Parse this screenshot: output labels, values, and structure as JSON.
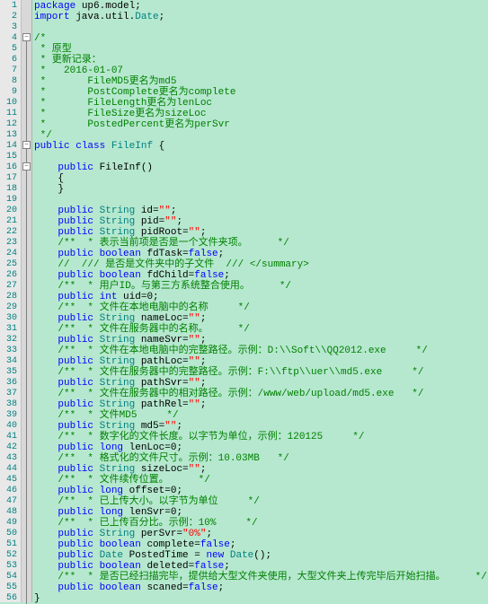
{
  "lines": [
    {
      "n": 1,
      "t": [
        {
          "c": "kw",
          "s": "package"
        },
        {
          "c": "",
          "s": " up6.model;"
        }
      ]
    },
    {
      "n": 2,
      "t": [
        {
          "c": "kw",
          "s": "import"
        },
        {
          "c": "",
          "s": " java.util."
        },
        {
          "c": "cls",
          "s": "Date"
        },
        {
          "c": "",
          "s": ";"
        }
      ]
    },
    {
      "n": 3,
      "t": []
    },
    {
      "n": 4,
      "t": [
        {
          "c": "cmt",
          "s": "/*"
        }
      ]
    },
    {
      "n": 5,
      "t": [
        {
          "c": "cmt",
          "s": " * 原型"
        }
      ]
    },
    {
      "n": 6,
      "t": [
        {
          "c": "cmt",
          "s": " * 更新记录："
        }
      ]
    },
    {
      "n": 7,
      "t": [
        {
          "c": "cmt",
          "s": " *   2016-01-07"
        }
      ]
    },
    {
      "n": 8,
      "t": [
        {
          "c": "cmt",
          "s": " *       FileMD5更名为md5"
        }
      ]
    },
    {
      "n": 9,
      "t": [
        {
          "c": "cmt",
          "s": " *       PostComplete更名为complete"
        }
      ]
    },
    {
      "n": 10,
      "t": [
        {
          "c": "cmt",
          "s": " *       FileLength更名为lenLoc"
        }
      ]
    },
    {
      "n": 11,
      "t": [
        {
          "c": "cmt",
          "s": " *       FileSize更名为sizeLoc"
        }
      ]
    },
    {
      "n": 12,
      "t": [
        {
          "c": "cmt",
          "s": " *       PostedPercent更名为perSvr"
        }
      ]
    },
    {
      "n": 13,
      "t": [
        {
          "c": "cmt",
          "s": " */"
        }
      ]
    },
    {
      "n": 14,
      "t": [
        {
          "c": "kw",
          "s": "public"
        },
        {
          "c": "",
          "s": " "
        },
        {
          "c": "kw",
          "s": "class"
        },
        {
          "c": "",
          "s": " "
        },
        {
          "c": "cls",
          "s": "FileInf"
        },
        {
          "c": "",
          "s": " {"
        }
      ]
    },
    {
      "n": 15,
      "t": []
    },
    {
      "n": 16,
      "t": [
        {
          "c": "",
          "s": "    "
        },
        {
          "c": "kw",
          "s": "public"
        },
        {
          "c": "",
          "s": " FileInf()"
        }
      ]
    },
    {
      "n": 17,
      "t": [
        {
          "c": "",
          "s": "    {"
        }
      ]
    },
    {
      "n": 18,
      "t": [
        {
          "c": "",
          "s": "    }"
        }
      ]
    },
    {
      "n": 19,
      "t": []
    },
    {
      "n": 20,
      "t": [
        {
          "c": "",
          "s": "    "
        },
        {
          "c": "kw",
          "s": "public"
        },
        {
          "c": "",
          "s": " "
        },
        {
          "c": "cls",
          "s": "String"
        },
        {
          "c": "",
          "s": " id="
        },
        {
          "c": "str",
          "s": "\"\""
        },
        {
          "c": "",
          "s": ";"
        }
      ]
    },
    {
      "n": 21,
      "t": [
        {
          "c": "",
          "s": "    "
        },
        {
          "c": "kw",
          "s": "public"
        },
        {
          "c": "",
          "s": " "
        },
        {
          "c": "cls",
          "s": "String"
        },
        {
          "c": "",
          "s": " pid="
        },
        {
          "c": "str",
          "s": "\"\""
        },
        {
          "c": "",
          "s": ";"
        }
      ]
    },
    {
      "n": 22,
      "t": [
        {
          "c": "",
          "s": "    "
        },
        {
          "c": "kw",
          "s": "public"
        },
        {
          "c": "",
          "s": " "
        },
        {
          "c": "cls",
          "s": "String"
        },
        {
          "c": "",
          "s": " pidRoot="
        },
        {
          "c": "str",
          "s": "\"\""
        },
        {
          "c": "",
          "s": ";"
        }
      ]
    },
    {
      "n": 23,
      "t": [
        {
          "c": "",
          "s": "    "
        },
        {
          "c": "cmt",
          "s": "/**  * 表示当前项是否是一个文件夹项。     */"
        }
      ]
    },
    {
      "n": 24,
      "t": [
        {
          "c": "",
          "s": "    "
        },
        {
          "c": "kw",
          "s": "public"
        },
        {
          "c": "",
          "s": " "
        },
        {
          "c": "kw",
          "s": "boolean"
        },
        {
          "c": "",
          "s": " fdTask="
        },
        {
          "c": "kw",
          "s": "false"
        },
        {
          "c": "",
          "s": ";"
        }
      ]
    },
    {
      "n": 25,
      "t": [
        {
          "c": "",
          "s": "    "
        },
        {
          "c": "cmt",
          "s": "//  /// 是否是文件夹中的子文件  /// </summary>"
        }
      ]
    },
    {
      "n": 26,
      "t": [
        {
          "c": "",
          "s": "    "
        },
        {
          "c": "kw",
          "s": "public"
        },
        {
          "c": "",
          "s": " "
        },
        {
          "c": "kw",
          "s": "boolean"
        },
        {
          "c": "",
          "s": " fdChild="
        },
        {
          "c": "kw",
          "s": "false"
        },
        {
          "c": "",
          "s": ";"
        }
      ]
    },
    {
      "n": 27,
      "t": [
        {
          "c": "",
          "s": "    "
        },
        {
          "c": "cmt",
          "s": "/**  * 用户ID。与第三方系统整合使用。     */"
        }
      ]
    },
    {
      "n": 28,
      "t": [
        {
          "c": "",
          "s": "    "
        },
        {
          "c": "kw",
          "s": "public"
        },
        {
          "c": "",
          "s": " "
        },
        {
          "c": "kw",
          "s": "int"
        },
        {
          "c": "",
          "s": " uid=0;"
        }
      ]
    },
    {
      "n": 29,
      "t": [
        {
          "c": "",
          "s": "    "
        },
        {
          "c": "cmt",
          "s": "/**  * 文件在本地电脑中的名称     */"
        }
      ]
    },
    {
      "n": 30,
      "t": [
        {
          "c": "",
          "s": "    "
        },
        {
          "c": "kw",
          "s": "public"
        },
        {
          "c": "",
          "s": " "
        },
        {
          "c": "cls",
          "s": "String"
        },
        {
          "c": "",
          "s": " nameLoc="
        },
        {
          "c": "str",
          "s": "\"\""
        },
        {
          "c": "",
          "s": ";"
        }
      ]
    },
    {
      "n": 31,
      "t": [
        {
          "c": "",
          "s": "    "
        },
        {
          "c": "cmt",
          "s": "/**  * 文件在服务器中的名称。     */"
        }
      ]
    },
    {
      "n": 32,
      "t": [
        {
          "c": "",
          "s": "    "
        },
        {
          "c": "kw",
          "s": "public"
        },
        {
          "c": "",
          "s": " "
        },
        {
          "c": "cls",
          "s": "String"
        },
        {
          "c": "",
          "s": " nameSvr="
        },
        {
          "c": "str",
          "s": "\"\""
        },
        {
          "c": "",
          "s": ";"
        }
      ]
    },
    {
      "n": 33,
      "t": [
        {
          "c": "",
          "s": "    "
        },
        {
          "c": "cmt",
          "s": "/**  * 文件在本地电脑中的完整路径。示例：D:\\\\Soft\\\\QQ2012.exe     */"
        }
      ]
    },
    {
      "n": 34,
      "t": [
        {
          "c": "",
          "s": "    "
        },
        {
          "c": "kw",
          "s": "public"
        },
        {
          "c": "",
          "s": " "
        },
        {
          "c": "cls",
          "s": "String"
        },
        {
          "c": "",
          "s": " pathLoc="
        },
        {
          "c": "str",
          "s": "\"\""
        },
        {
          "c": "",
          "s": ";"
        }
      ]
    },
    {
      "n": 35,
      "t": [
        {
          "c": "",
          "s": "    "
        },
        {
          "c": "cmt",
          "s": "/**  * 文件在服务器中的完整路径。示例：F:\\\\ftp\\\\uer\\\\md5.exe     */"
        }
      ]
    },
    {
      "n": 36,
      "t": [
        {
          "c": "",
          "s": "    "
        },
        {
          "c": "kw",
          "s": "public"
        },
        {
          "c": "",
          "s": " "
        },
        {
          "c": "cls",
          "s": "String"
        },
        {
          "c": "",
          "s": " pathSvr="
        },
        {
          "c": "str",
          "s": "\"\""
        },
        {
          "c": "",
          "s": ";"
        }
      ]
    },
    {
      "n": 37,
      "t": [
        {
          "c": "",
          "s": "    "
        },
        {
          "c": "cmt",
          "s": "/**  * 文件在服务器中的相对路径。示例：/www/web/upload/md5.exe   */"
        }
      ]
    },
    {
      "n": 38,
      "t": [
        {
          "c": "",
          "s": "    "
        },
        {
          "c": "kw",
          "s": "public"
        },
        {
          "c": "",
          "s": " "
        },
        {
          "c": "cls",
          "s": "String"
        },
        {
          "c": "",
          "s": " pathRel="
        },
        {
          "c": "str",
          "s": "\"\""
        },
        {
          "c": "",
          "s": ";"
        }
      ]
    },
    {
      "n": 39,
      "t": [
        {
          "c": "",
          "s": "    "
        },
        {
          "c": "cmt",
          "s": "/**  * 文件MD5     */"
        }
      ]
    },
    {
      "n": 40,
      "t": [
        {
          "c": "",
          "s": "    "
        },
        {
          "c": "kw",
          "s": "public"
        },
        {
          "c": "",
          "s": " "
        },
        {
          "c": "cls",
          "s": "String"
        },
        {
          "c": "",
          "s": " md5="
        },
        {
          "c": "str",
          "s": "\"\""
        },
        {
          "c": "",
          "s": ";"
        }
      ]
    },
    {
      "n": 41,
      "t": [
        {
          "c": "",
          "s": "    "
        },
        {
          "c": "cmt",
          "s": "/**  * 数字化的文件长度。以字节为单位，示例：120125     */"
        }
      ]
    },
    {
      "n": 42,
      "t": [
        {
          "c": "",
          "s": "    "
        },
        {
          "c": "kw",
          "s": "public"
        },
        {
          "c": "",
          "s": " "
        },
        {
          "c": "kw",
          "s": "long"
        },
        {
          "c": "",
          "s": " lenLoc=0;"
        }
      ]
    },
    {
      "n": 43,
      "t": [
        {
          "c": "",
          "s": "    "
        },
        {
          "c": "cmt",
          "s": "/**  * 格式化的文件尺寸。示例：10.03MB   */"
        }
      ]
    },
    {
      "n": 44,
      "t": [
        {
          "c": "",
          "s": "    "
        },
        {
          "c": "kw",
          "s": "public"
        },
        {
          "c": "",
          "s": " "
        },
        {
          "c": "cls",
          "s": "String"
        },
        {
          "c": "",
          "s": " sizeLoc="
        },
        {
          "c": "str",
          "s": "\"\""
        },
        {
          "c": "",
          "s": ";"
        }
      ]
    },
    {
      "n": 45,
      "t": [
        {
          "c": "",
          "s": "    "
        },
        {
          "c": "cmt",
          "s": "/**  * 文件续传位置。     */"
        }
      ]
    },
    {
      "n": 46,
      "t": [
        {
          "c": "",
          "s": "    "
        },
        {
          "c": "kw",
          "s": "public"
        },
        {
          "c": "",
          "s": " "
        },
        {
          "c": "kw",
          "s": "long"
        },
        {
          "c": "",
          "s": " offset=0;"
        }
      ]
    },
    {
      "n": 47,
      "t": [
        {
          "c": "",
          "s": "    "
        },
        {
          "c": "cmt",
          "s": "/**  * 已上传大小。以字节为单位     */"
        }
      ]
    },
    {
      "n": 48,
      "t": [
        {
          "c": "",
          "s": "    "
        },
        {
          "c": "kw",
          "s": "public"
        },
        {
          "c": "",
          "s": " "
        },
        {
          "c": "kw",
          "s": "long"
        },
        {
          "c": "",
          "s": " lenSvr=0;"
        }
      ]
    },
    {
      "n": 49,
      "t": [
        {
          "c": "",
          "s": "    "
        },
        {
          "c": "cmt",
          "s": "/**  * 已上传百分比。示例：10%     */"
        }
      ]
    },
    {
      "n": 50,
      "t": [
        {
          "c": "",
          "s": "    "
        },
        {
          "c": "kw",
          "s": "public"
        },
        {
          "c": "",
          "s": " "
        },
        {
          "c": "cls",
          "s": "String"
        },
        {
          "c": "",
          "s": " perSvr="
        },
        {
          "c": "str",
          "s": "\"0%\""
        },
        {
          "c": "",
          "s": ";"
        }
      ]
    },
    {
      "n": 51,
      "t": [
        {
          "c": "",
          "s": "    "
        },
        {
          "c": "kw",
          "s": "public"
        },
        {
          "c": "",
          "s": " "
        },
        {
          "c": "kw",
          "s": "boolean"
        },
        {
          "c": "",
          "s": " complete="
        },
        {
          "c": "kw",
          "s": "false"
        },
        {
          "c": "",
          "s": ";"
        }
      ]
    },
    {
      "n": 52,
      "t": [
        {
          "c": "",
          "s": "    "
        },
        {
          "c": "kw",
          "s": "public"
        },
        {
          "c": "",
          "s": " "
        },
        {
          "c": "cls",
          "s": "Date"
        },
        {
          "c": "",
          "s": " PostedTime = "
        },
        {
          "c": "kw",
          "s": "new"
        },
        {
          "c": "",
          "s": " "
        },
        {
          "c": "cls",
          "s": "Date"
        },
        {
          "c": "",
          "s": "();"
        }
      ]
    },
    {
      "n": 53,
      "t": [
        {
          "c": "",
          "s": "    "
        },
        {
          "c": "kw",
          "s": "public"
        },
        {
          "c": "",
          "s": " "
        },
        {
          "c": "kw",
          "s": "boolean"
        },
        {
          "c": "",
          "s": " deleted="
        },
        {
          "c": "kw",
          "s": "false"
        },
        {
          "c": "",
          "s": ";"
        }
      ]
    },
    {
      "n": 54,
      "t": [
        {
          "c": "",
          "s": "    "
        },
        {
          "c": "cmt",
          "s": "/**  * 是否已经扫描完毕，提供给大型文件夹使用，大型文件夹上传完毕后开始扫描。     */"
        }
      ]
    },
    {
      "n": 55,
      "t": [
        {
          "c": "",
          "s": "    "
        },
        {
          "c": "kw",
          "s": "public"
        },
        {
          "c": "",
          "s": " "
        },
        {
          "c": "kw",
          "s": "boolean"
        },
        {
          "c": "",
          "s": " scaned="
        },
        {
          "c": "kw",
          "s": "false"
        },
        {
          "c": "",
          "s": ";"
        }
      ]
    },
    {
      "n": 56,
      "t": [
        {
          "c": "",
          "s": "}"
        }
      ]
    }
  ],
  "fold_markers": [
    {
      "line": 4,
      "sym": "−"
    },
    {
      "line": 14,
      "sym": "−"
    },
    {
      "line": 16,
      "sym": "−"
    }
  ],
  "fold_segments": [
    {
      "from": 4,
      "to": 56
    }
  ]
}
